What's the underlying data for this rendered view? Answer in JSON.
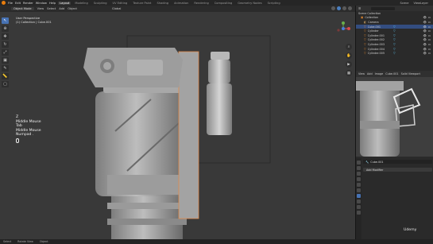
{
  "topbar": {
    "menus": [
      "File",
      "Edit",
      "Render",
      "Window",
      "Help"
    ],
    "workspaces": [
      "Layout",
      "Modeling",
      "Sculpting",
      "UV Editing",
      "Texture Paint",
      "Shading",
      "Animation",
      "Rendering",
      "Compositing",
      "Geometry Nodes",
      "Scripting"
    ],
    "active_workspace": "Layout",
    "scene": "Scene",
    "view_layer": "ViewLayer"
  },
  "viewport_header": {
    "mode": "Object Mode",
    "menus": [
      "View",
      "Select",
      "Add",
      "Object"
    ],
    "orientation": "Global"
  },
  "viewport": {
    "view_name": "User Perspective",
    "collection_info": "(1) Collection | Cube.001",
    "key_overlay": [
      "Z",
      "Middle Mouse",
      "Tab",
      "Middle Mouse",
      "Numpad ."
    ]
  },
  "outliner": {
    "title": "Scene Collection",
    "rows": [
      {
        "label": "Collection",
        "selected": false,
        "kind": "collection"
      },
      {
        "label": "Camera",
        "selected": false,
        "kind": "camera"
      },
      {
        "label": "Cube.001",
        "selected": true,
        "kind": "mesh"
      },
      {
        "label": "Cylinder",
        "selected": false,
        "kind": "mesh"
      },
      {
        "label": "Cylinder.001",
        "selected": false,
        "kind": "mesh"
      },
      {
        "label": "Cylinder.002",
        "selected": false,
        "kind": "mesh"
      },
      {
        "label": "Cylinder.003",
        "selected": false,
        "kind": "mesh"
      },
      {
        "label": "Cylinder.004",
        "selected": false,
        "kind": "mesh"
      },
      {
        "label": "Cylinder.005",
        "selected": false,
        "kind": "mesh"
      }
    ]
  },
  "sub_viewport_header": {
    "items": [
      "View",
      "Add",
      "Image"
    ],
    "image": "Cube.001",
    "option": "Solid Viewport"
  },
  "properties": {
    "object_name": "Cube.001",
    "add_modifier": "Add Modifier"
  },
  "statusbar": {
    "items": [
      "Select",
      "Rotate View",
      "Object"
    ],
    "watermark": "Udemy"
  },
  "colors": {
    "accent": "#4772b3",
    "orange": "#e87d0d",
    "selection": "#334d80"
  }
}
